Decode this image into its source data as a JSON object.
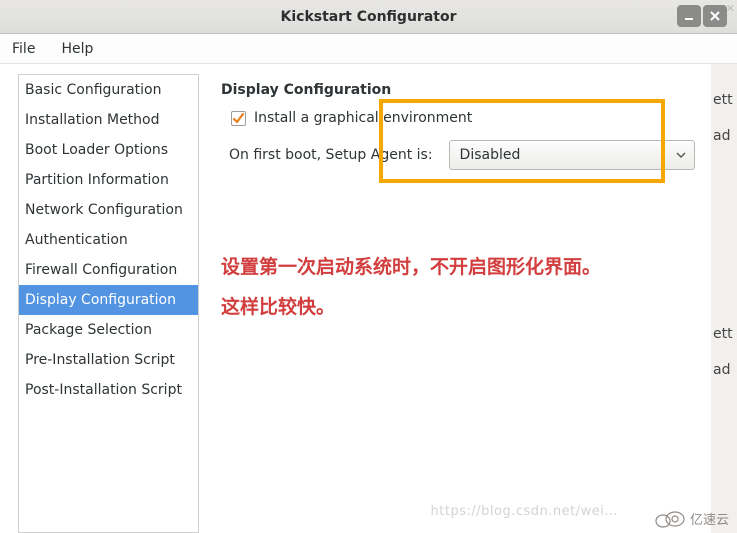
{
  "window": {
    "title": "Kickstart Configurator"
  },
  "menubar": {
    "file": "File",
    "help": "Help"
  },
  "sidebar": {
    "items": [
      {
        "label": "Basic Configuration"
      },
      {
        "label": "Installation Method"
      },
      {
        "label": "Boot Loader Options"
      },
      {
        "label": "Partition Information"
      },
      {
        "label": "Network Configuration"
      },
      {
        "label": "Authentication"
      },
      {
        "label": "Firewall Configuration"
      },
      {
        "label": "Display Configuration"
      },
      {
        "label": "Package Selection"
      },
      {
        "label": "Pre-Installation Script"
      },
      {
        "label": "Post-Installation Script"
      }
    ],
    "selected_index": 7
  },
  "panel": {
    "title": "Display Configuration",
    "install_graphical_label": "Install a graphical environment",
    "install_graphical_checked": true,
    "setup_agent_label": "On first boot, Setup Agent is:",
    "setup_agent_value": "Disabled"
  },
  "annotation": {
    "line1": "设置第一次启动系统时，不开启图形化界面。",
    "line2": "这样比较快。"
  },
  "right_strip": {
    "t1": "ett",
    "t2": "ad",
    "t3": "ett",
    "t4": "ad"
  },
  "watermark": {
    "url": "https://blog.csdn.net/wei…",
    "logo_text": "亿速云"
  }
}
